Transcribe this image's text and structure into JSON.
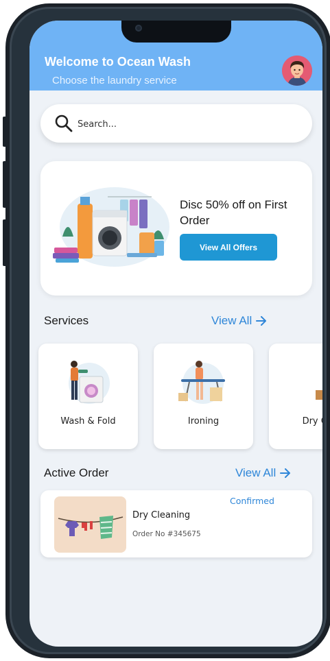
{
  "header": {
    "welcome": "Welcome to Ocean Wash",
    "subtitle": "Choose the laundry service"
  },
  "avatar_icon": "user-avatar",
  "search": {
    "placeholder": "Search...",
    "icon": "search-icon"
  },
  "promo": {
    "title": "Disc 50% off on First Order",
    "button_label": "View All Offers"
  },
  "services": {
    "title": "Services",
    "view_all": "View All",
    "items": [
      {
        "label": "Wash & Fold",
        "icon": "washing-machine-illustration"
      },
      {
        "label": "Ironing",
        "icon": "ironing-illustration"
      },
      {
        "label": "Dry Cle",
        "icon": "dry-cleaning-illustration"
      }
    ]
  },
  "active_order": {
    "title": "Active Order",
    "view_all": "View All",
    "order": {
      "name": "Dry Cleaning",
      "number": "Order No #345675",
      "status": "Confirmed"
    }
  },
  "colors": {
    "header": "#6fb3f5",
    "accent": "#2e86d8",
    "button": "#1f97d4",
    "background": "#eef2f7"
  }
}
